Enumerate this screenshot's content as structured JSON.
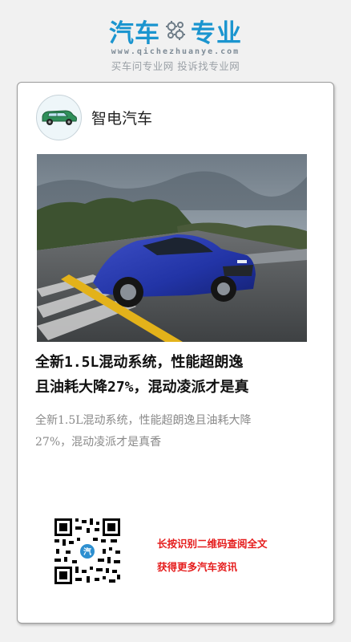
{
  "brand": {
    "name_left": "汽车",
    "name_right": "专业",
    "url": "www.qichezhuanye.com",
    "slogan": "买车问专业网 投诉找专业网",
    "icon": "gear-icon",
    "color": "#1b95cf"
  },
  "post": {
    "author": "智电汽车",
    "avatar_icon": "green-car-icon",
    "title_lines": [
      "全新1.5L混动系统，性能超朗逸",
      "且油耗大降27%，混动凌派才是真"
    ],
    "summary_lines": [
      "全新1.5L混动系统，性能超朗逸且油耗大降",
      "27%，混动凌派才是真香"
    ],
    "hero_image": "blue-sedan-photo"
  },
  "footer": {
    "qr_icon": "qr-code",
    "cta_line1": "长按识别二维码查阅全文",
    "cta_line2": "获得更多汽车资讯",
    "cta_color": "#e51c1c"
  }
}
